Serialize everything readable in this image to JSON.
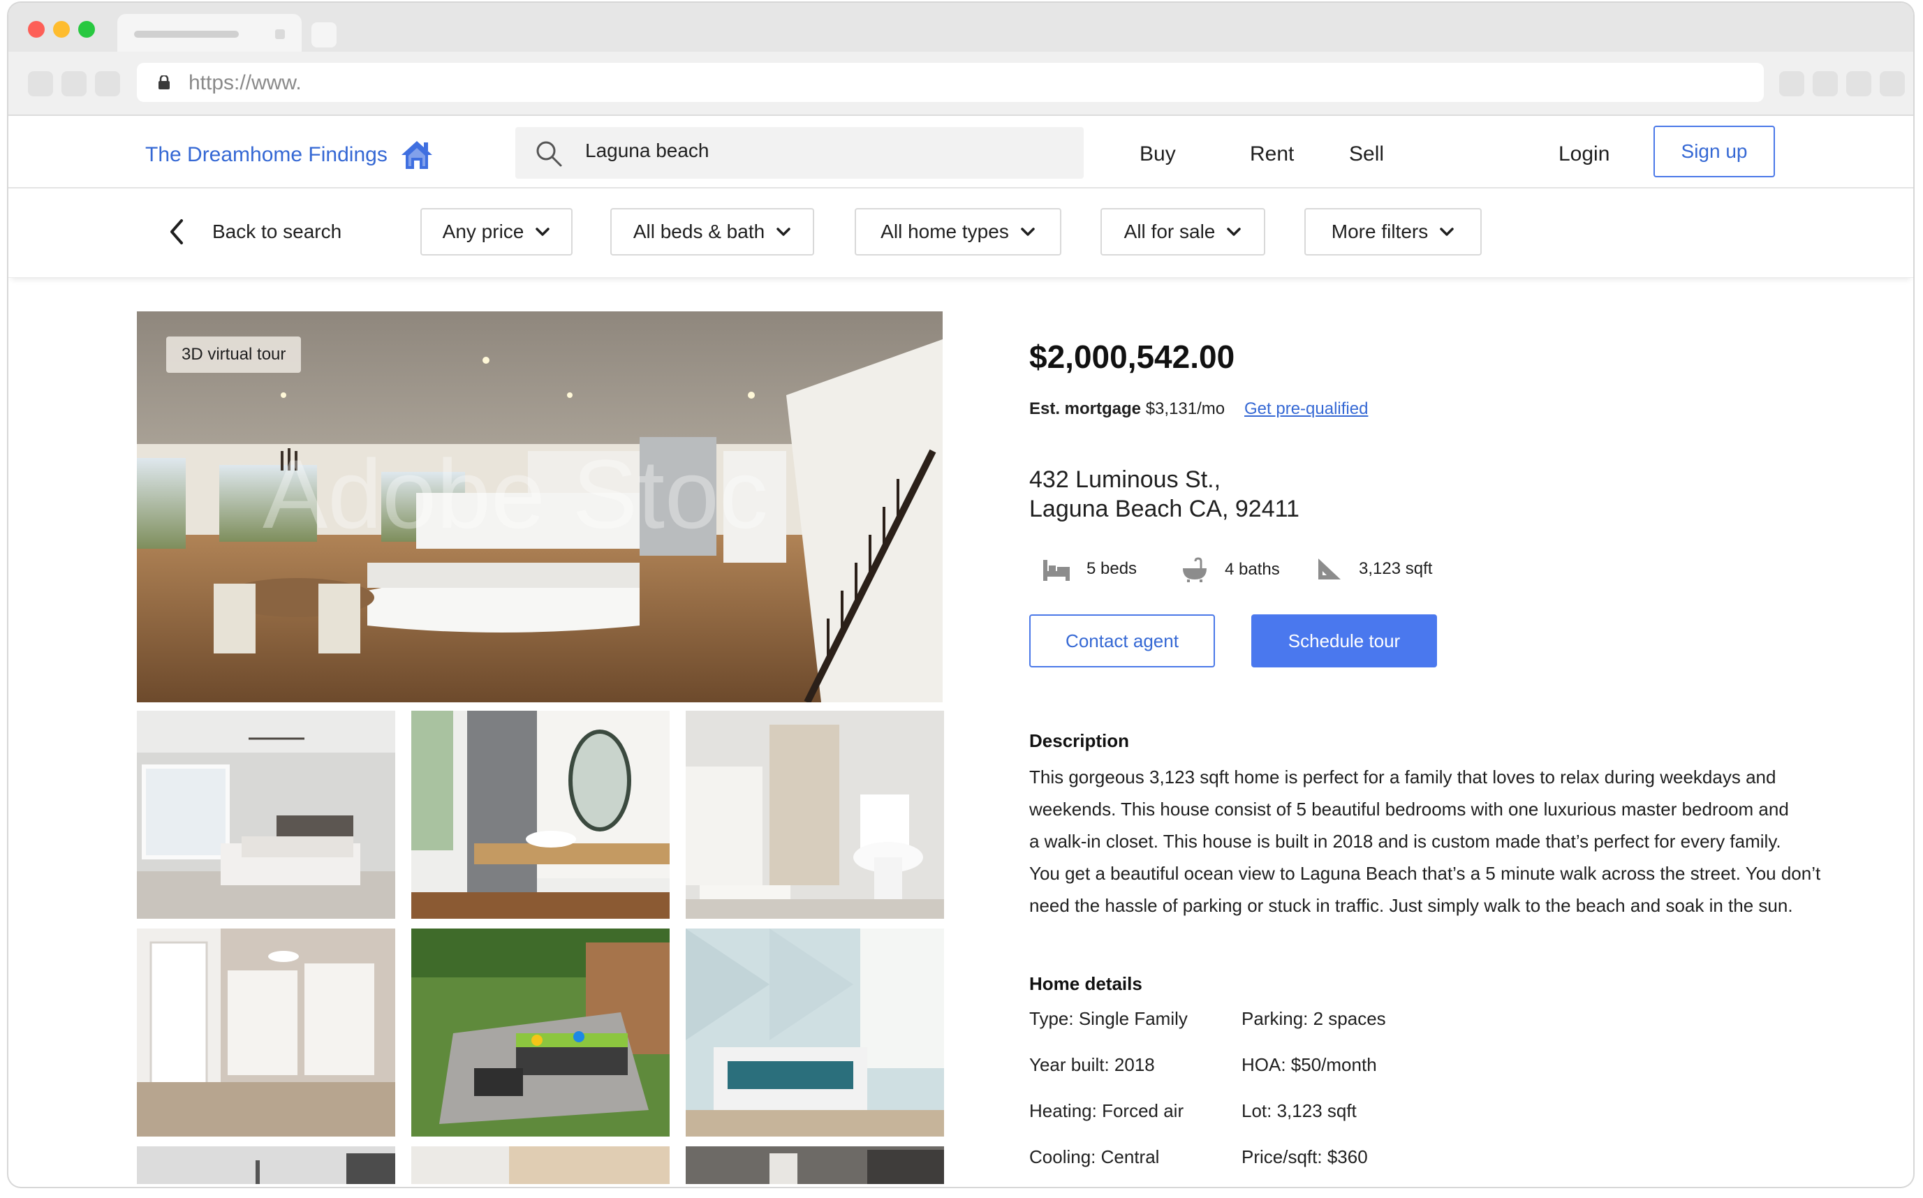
{
  "browser": {
    "url": "https://www."
  },
  "header": {
    "brand": "The Dreamhome Findings",
    "search_value": "Laguna beach",
    "nav": [
      "Buy",
      "Rent",
      "Sell"
    ],
    "login": "Login",
    "signup": "Sign up"
  },
  "filters": {
    "back": "Back to search",
    "items": [
      "Any price",
      "All beds & bath",
      "All home types",
      "All for sale",
      "More filters"
    ]
  },
  "gallery": {
    "badge": "3D virtual tour",
    "watermark": "Adobe Stoc"
  },
  "listing": {
    "price": "$2,000,542.00",
    "mortgage_label": "Est. mortgage",
    "mortgage_value": "$3,131/mo",
    "prequal": "Get pre-qualified",
    "address_line1": "432 Luminous St.,",
    "address_line2": "Laguna Beach CA, 92411",
    "beds": "5 beds",
    "baths": "4 baths",
    "sqft": "3,123 sqft",
    "contact": "Contact agent",
    "schedule": "Schedule tour"
  },
  "description": {
    "heading": "Description",
    "lines": [
      "This gorgeous 3,123 sqft home is perfect for a family that loves to relax during weekdays and",
      "weekends. This house consist of 5 beautiful bedrooms with one luxurious master bedroom and",
      "a walk-in closet. This house is built in 2018 and is custom made that’s perfect for every family.",
      "You get a beautiful ocean view to Laguna Beach that’s a 5 minute walk across the street. You don’t",
      "need the hassle of parking or stuck in traffic. Just simply walk to the beach and soak in the sun."
    ]
  },
  "home_details": {
    "heading": "Home details",
    "left": [
      "Type: Single Family",
      "Year built: 2018",
      "Heating: Forced air",
      "Cooling: Central"
    ],
    "right": [
      "Parking: 2 spaces",
      "HOA: $50/month",
      "Lot: 3,123 sqft",
      "Price/sqft: $360"
    ]
  },
  "colors": {
    "accent": "#4a78ee",
    "brand": "#3568d4"
  }
}
